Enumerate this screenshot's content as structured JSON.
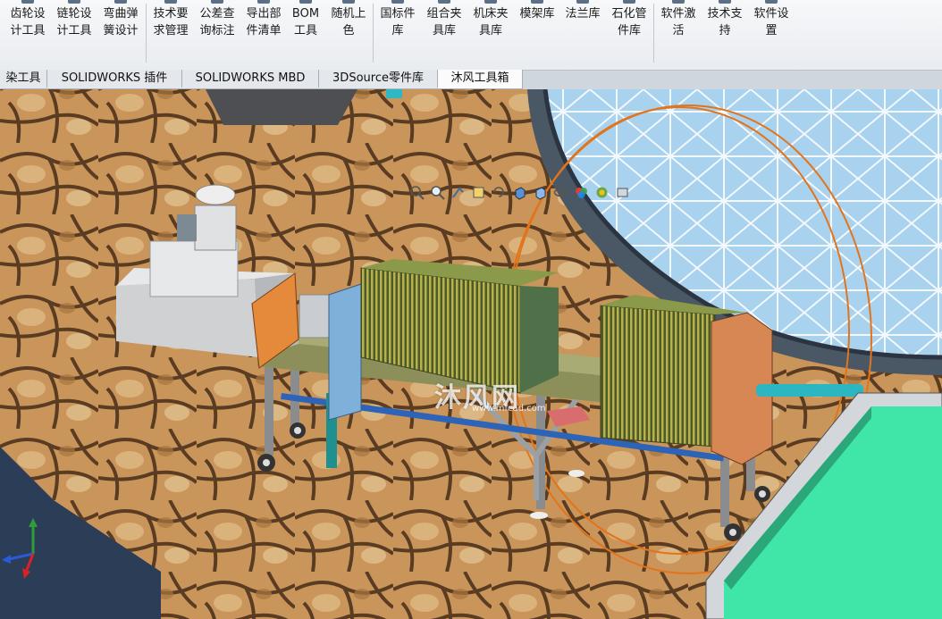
{
  "ribbon": {
    "buttons": [
      {
        "label": "齿轮设\n计工具",
        "icon": "gear-icon"
      },
      {
        "label": "链轮设\n计工具",
        "icon": "sprocket-icon"
      },
      {
        "label": "弯曲弹\n簧设计",
        "icon": "spring-icon"
      },
      {
        "label": "技术要\n求管理",
        "icon": "document-icon"
      },
      {
        "label": "公差查\n询标注",
        "icon": "tolerance-icon"
      },
      {
        "label": "导出部\n件清单",
        "icon": "export-icon"
      },
      {
        "label": "BOM\n工具",
        "icon": "bom-icon"
      },
      {
        "label": "随机上\n色",
        "icon": "palette-icon"
      },
      {
        "label": "国标件\n库",
        "icon": "library-icon"
      },
      {
        "label": "组合夹\n具库",
        "icon": "fixture-icon"
      },
      {
        "label": "机床夹\n具库",
        "icon": "clamp-icon"
      },
      {
        "label": "模架库",
        "icon": "mold-icon"
      },
      {
        "label": "法兰库",
        "icon": "flange-icon"
      },
      {
        "label": "石化管\n件库",
        "icon": "pipe-icon"
      },
      {
        "label": "软件激\n活",
        "icon": "key-icon"
      },
      {
        "label": "技术支\n持",
        "icon": "support-icon"
      },
      {
        "label": "软件设\n置",
        "icon": "settings-icon"
      }
    ]
  },
  "tabs": [
    {
      "label": "染工具",
      "active": false
    },
    {
      "label": "SOLIDWORKS 插件",
      "active": false
    },
    {
      "label": "SOLIDWORKS MBD",
      "active": false
    },
    {
      "label": "3DSource零件库",
      "active": false
    },
    {
      "label": "沐风工具箱",
      "active": true
    }
  ],
  "heads_up_toolbar": [
    "zoom-to-fit-icon",
    "zoom-area-icon",
    "previous-view-icon",
    "section-view-icon",
    "dynamic-annotation-icon",
    "view-orientation-icon",
    "display-style-icon",
    "hide-show-icon",
    "edit-appearance-icon",
    "apply-scene-icon",
    "view-settings-icon"
  ],
  "watermark": {
    "text": "沐风网",
    "url": "www.mfcad.com"
  },
  "colors": {
    "accent": "#1f5fa8",
    "ribbon_bg": "#eef0f3",
    "tank_liquid": "#3fe6a8"
  }
}
